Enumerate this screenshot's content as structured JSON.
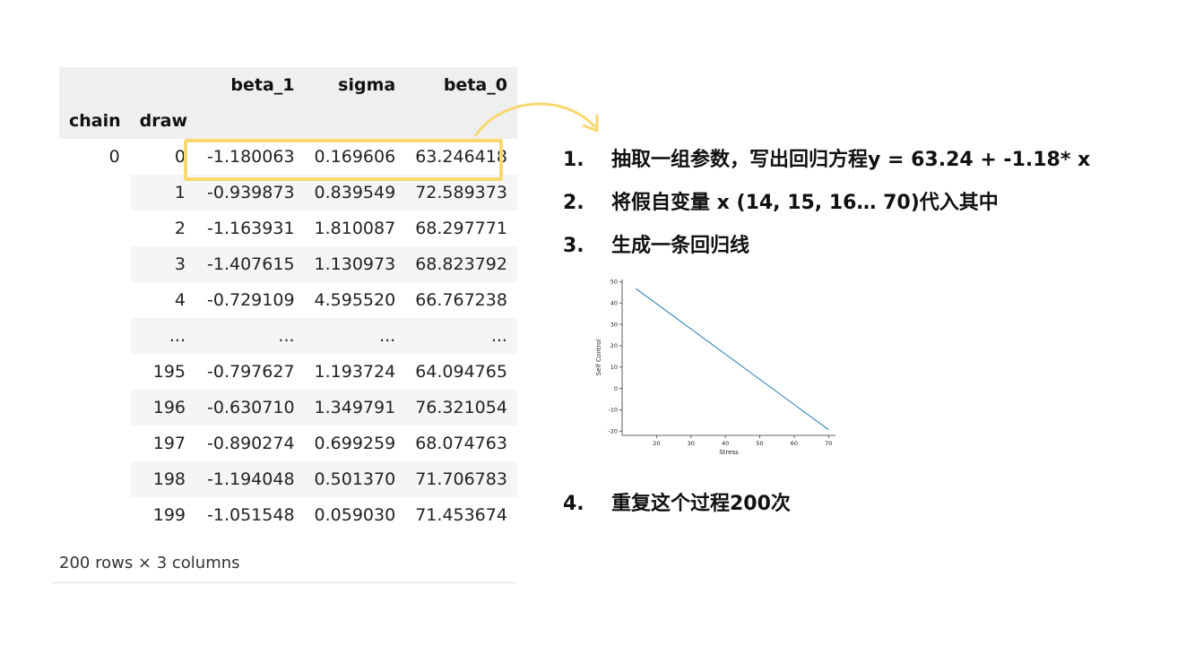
{
  "table": {
    "columns": [
      "beta_1",
      "sigma",
      "beta_0"
    ],
    "index_names": [
      "chain",
      "draw"
    ],
    "rows": [
      {
        "chain": "0",
        "draw": "0",
        "beta_1": "-1.180063",
        "sigma": "0.169606",
        "beta_0": "63.246418"
      },
      {
        "chain": "",
        "draw": "1",
        "beta_1": "-0.939873",
        "sigma": "0.839549",
        "beta_0": "72.589373"
      },
      {
        "chain": "",
        "draw": "2",
        "beta_1": "-1.163931",
        "sigma": "1.810087",
        "beta_0": "68.297771"
      },
      {
        "chain": "",
        "draw": "3",
        "beta_1": "-1.407615",
        "sigma": "1.130973",
        "beta_0": "68.823792"
      },
      {
        "chain": "",
        "draw": "4",
        "beta_1": "-0.729109",
        "sigma": "4.595520",
        "beta_0": "66.767238"
      },
      {
        "chain": "",
        "draw": "...",
        "beta_1": "...",
        "sigma": "...",
        "beta_0": "..."
      },
      {
        "chain": "",
        "draw": "195",
        "beta_1": "-0.797627",
        "sigma": "1.193724",
        "beta_0": "64.094765"
      },
      {
        "chain": "",
        "draw": "196",
        "beta_1": "-0.630710",
        "sigma": "1.349791",
        "beta_0": "76.321054"
      },
      {
        "chain": "",
        "draw": "197",
        "beta_1": "-0.890274",
        "sigma": "0.699259",
        "beta_0": "68.074763"
      },
      {
        "chain": "",
        "draw": "198",
        "beta_1": "-1.194048",
        "sigma": "0.501370",
        "beta_0": "71.706783"
      },
      {
        "chain": "",
        "draw": "199",
        "beta_1": "-1.051548",
        "sigma": "0.059030",
        "beta_0": "71.453674"
      }
    ],
    "footer": "200 rows × 3 columns"
  },
  "steps": [
    {
      "num": "1.",
      "text": "抽取一组参数，写出回归方程y = 63.24 + -1.18* x"
    },
    {
      "num": "2.",
      "text": "将假自变量 x (14, 15, 16… 70)代入其中"
    },
    {
      "num": "3.",
      "text": "生成一条回归线"
    },
    {
      "num": "4.",
      "text": "重复这个过程200次"
    }
  ],
  "colors": {
    "highlight": "#f9d86f",
    "line": "#1f77b4",
    "header_bg": "#efefef",
    "stripe_bg": "#f5f5f5"
  },
  "chart_data": {
    "type": "line",
    "xlabel": "Stress",
    "ylabel": "Self Control",
    "xlim": [
      10,
      72
    ],
    "ylim": [
      -22,
      51
    ],
    "xticks": [
      20,
      30,
      40,
      50,
      60,
      70
    ],
    "yticks": [
      -20,
      -10,
      0,
      10,
      20,
      30,
      40,
      50
    ],
    "series": [
      {
        "x": [
          14,
          70
        ],
        "y": [
          46.72,
          -19.36
        ]
      }
    ],
    "grid": false
  }
}
